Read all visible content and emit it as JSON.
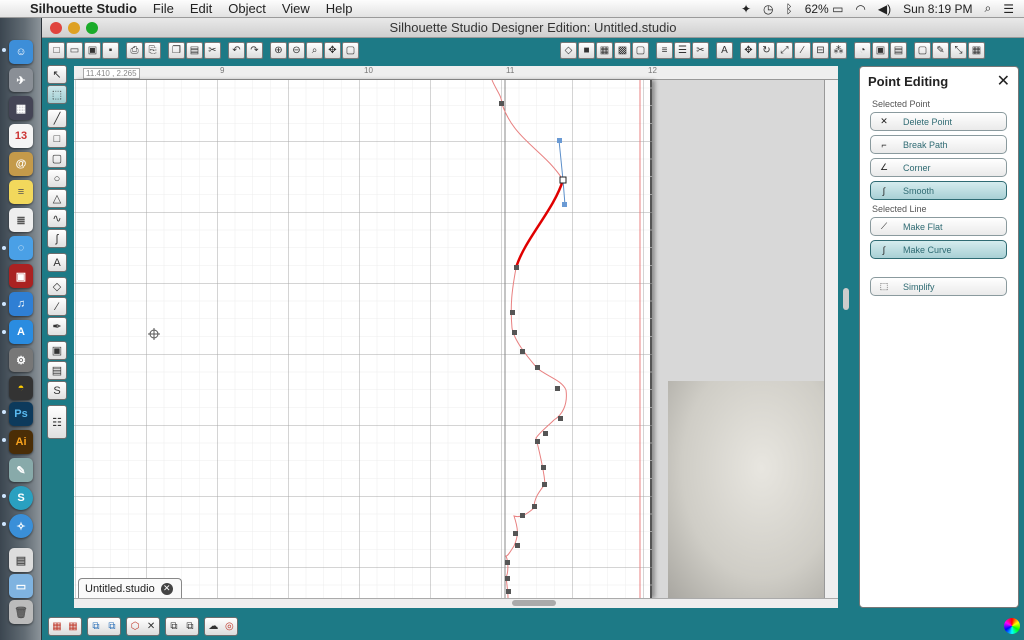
{
  "menubar": {
    "app_name": "Silhouette Studio",
    "menus": [
      "File",
      "Edit",
      "Object",
      "View",
      "Help"
    ],
    "battery": "62%",
    "clock": "Sun 8:19 PM"
  },
  "window": {
    "title": "Silhouette Studio Designer Edition: Untitled.studio"
  },
  "canvas": {
    "coordinates": "11.410 , 2.265",
    "ruler_labels": [
      "9",
      "10",
      "11",
      "12"
    ]
  },
  "document_tab": {
    "label": "Untitled.studio"
  },
  "panel": {
    "title": "Point Editing",
    "selected_point_heading": "Selected Point",
    "point_buttons": [
      {
        "label": "Delete Point",
        "icon": "delete-point-icon",
        "active": false
      },
      {
        "label": "Break Path",
        "icon": "break-path-icon",
        "active": false
      },
      {
        "label": "Corner",
        "icon": "corner-icon",
        "active": false
      },
      {
        "label": "Smooth",
        "icon": "smooth-icon",
        "active": true
      }
    ],
    "selected_line_heading": "Selected Line",
    "line_buttons": [
      {
        "label": "Make Flat",
        "icon": "make-flat-icon",
        "active": false
      },
      {
        "label": "Make Curve",
        "icon": "make-curve-icon",
        "active": true
      }
    ],
    "simplify_label": "Simplify"
  },
  "colors": {
    "accent": "#1d7a86",
    "selected_path": "#e00000",
    "path": "#e88080"
  }
}
